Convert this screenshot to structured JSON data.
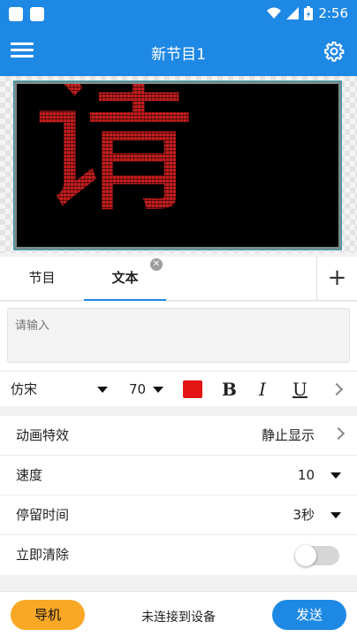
{
  "status_bar": {
    "time": "2:56"
  },
  "app_bar": {
    "title": "新节目1"
  },
  "preview": {
    "display_text": "请",
    "text_color": "#c51d1d"
  },
  "tabs": [
    {
      "label": "节目"
    },
    {
      "label": "文本"
    }
  ],
  "tab_add": "+",
  "text_input": {
    "placeholder": "请输入"
  },
  "font_toolbar": {
    "font_name": "仿宋",
    "font_size": "70",
    "text_color": "#e31414",
    "bold": "B",
    "italic": "I",
    "underline": "U"
  },
  "settings": {
    "animation": {
      "label": "动画特效",
      "value": "静止显示"
    },
    "speed": {
      "label": "速度",
      "value": "10"
    },
    "stay_time": {
      "label": "停留时间",
      "value": "3秒"
    },
    "clear_now": {
      "label": "立即清除",
      "enabled": false
    }
  },
  "bottom": {
    "nav_label": "导机",
    "status": "未连接到设备",
    "send_label": "发送"
  },
  "colors": {
    "primary": "#1e88e5",
    "accent": "#f9a825"
  }
}
